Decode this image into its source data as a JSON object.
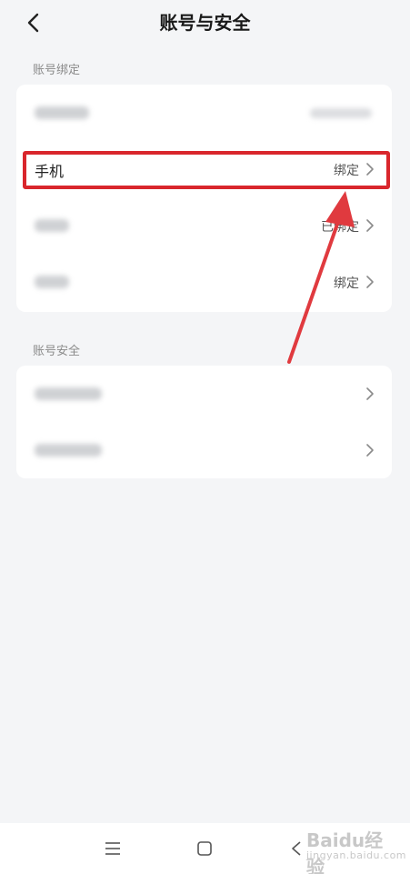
{
  "header": {
    "title": "账号与安全",
    "back_icon": "chevron-left-icon"
  },
  "sections": {
    "binding": {
      "label": "账号绑定",
      "rows": [
        {
          "label": "",
          "value": ""
        },
        {
          "label": "手机",
          "value": "绑定"
        },
        {
          "label": "",
          "value": "已绑定"
        },
        {
          "label": "",
          "value": "绑定"
        }
      ]
    },
    "security": {
      "label": "账号安全",
      "rows": [
        {
          "label": ""
        },
        {
          "label": ""
        }
      ]
    }
  },
  "annotation": {
    "highlight_color": "#d9262c"
  },
  "navbar": {
    "icons": [
      "menu-icon",
      "home-square-icon",
      "back-triangle-icon"
    ]
  },
  "watermark": {
    "main": "Baidu经验",
    "sub": "jingyan.baidu.com"
  }
}
